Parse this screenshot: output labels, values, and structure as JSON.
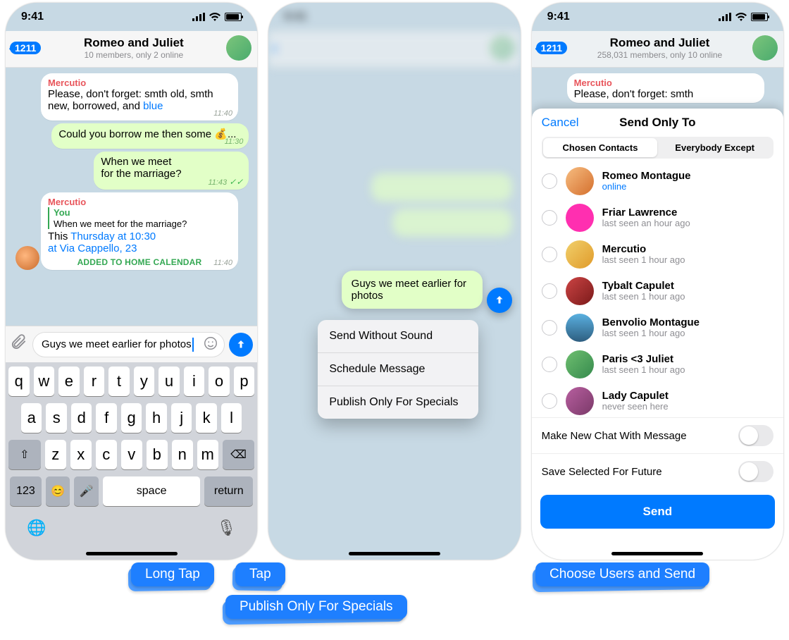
{
  "status_time": "9:41",
  "screen1": {
    "back_badge": "1211",
    "title": "Romeo and Juliet",
    "subtitle": "10 members, only 2 online",
    "msgs": {
      "m1_sender": "Mercutio",
      "m1_text_a": "Please, don't forget: smth old, smth new, borrowed, and ",
      "m1_link": "blue",
      "m1_time": "11:40",
      "m2_text": "Could you borrow me then some 💰...",
      "m2_time": "11:30",
      "m3_text_a": "When we meet",
      "m3_text_b": "for the marriage?",
      "m3_time": "11:43",
      "m4_sender": "Mercutio",
      "m4_reply_who": "You",
      "m4_reply_text": "When we meet for the marriage?",
      "m4_text_a": "This ",
      "m4_link1": "Thursday at 10:30",
      "m4_link2": "at Via Cappello, 23",
      "m4_time": "11:40",
      "m4_cal": "ADDED TO HOME CALENDAR"
    },
    "draft": "Guys we meet earlier for photos",
    "kb": {
      "row1": [
        "q",
        "w",
        "e",
        "r",
        "t",
        "y",
        "u",
        "i",
        "o",
        "p"
      ],
      "row2": [
        "a",
        "s",
        "d",
        "f",
        "g",
        "h",
        "j",
        "k",
        "l"
      ],
      "row3_shift": "⇧",
      "row3": [
        "z",
        "x",
        "c",
        "v",
        "b",
        "n",
        "m"
      ],
      "row3_del": "⌫",
      "row4_123": "123",
      "row4_emoji": "☺",
      "row4_mic": "🎤",
      "row4_space": "space",
      "row4_return": "return",
      "globe": "🌐",
      "dictate": "🎙"
    }
  },
  "screen2": {
    "preview": "Guys we meet earlier for photos",
    "menu": [
      "Send Without Sound",
      "Schedule Message",
      "Publish Only For Specials"
    ]
  },
  "screen3": {
    "back_badge": "1211",
    "title": "Romeo and Juliet",
    "subtitle": "258,031 members, only 10 online",
    "peek_sender": "Mercutio",
    "peek_text": "Please, don't forget: smth",
    "sheet": {
      "cancel": "Cancel",
      "title": "Send Only To",
      "seg": [
        "Chosen Contacts",
        "Everybody Except"
      ],
      "contacts": [
        {
          "name": "Romeo Montague",
          "status": "online",
          "online": true
        },
        {
          "name": "Friar Lawrence",
          "status": "last seen an hour ago"
        },
        {
          "name": "Mercutio",
          "status": "last seen 1 hour ago"
        },
        {
          "name": "Tybalt Capulet",
          "status": "last seen 1 hour ago"
        },
        {
          "name": "Benvolio Montague",
          "status": "last seen 1 hour ago"
        },
        {
          "name": "Paris <3 Juliet",
          "status": "last seen 1 hour ago"
        },
        {
          "name": "Lady Capulet",
          "status": "never seen here"
        }
      ],
      "opt1": "Make New Chat With Message",
      "opt2": "Save Selected For Future",
      "send": "Send"
    }
  },
  "captions": {
    "a": "Long Tap",
    "b": "Tap",
    "c": "Publish Only For Specials",
    "d": "Choose Users and Send"
  }
}
